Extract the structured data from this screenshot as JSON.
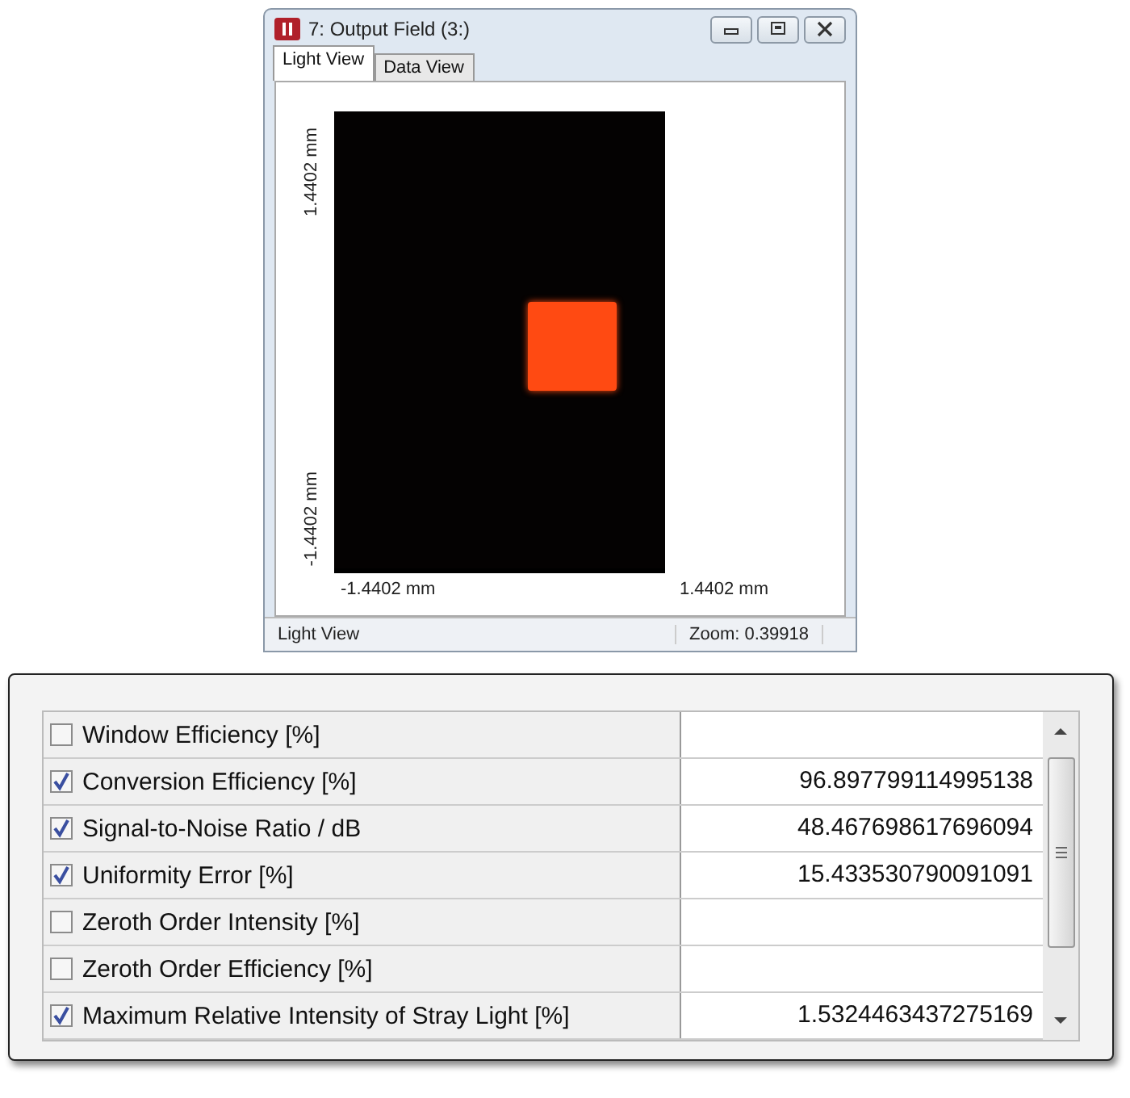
{
  "window": {
    "title": "7: Output Field (3:)"
  },
  "tabs": [
    {
      "label": "Light View",
      "selected": true
    },
    {
      "label": "Data View",
      "selected": false
    }
  ],
  "plot": {
    "y_top": "1.4402 mm",
    "y_bottom": "-1.4402 mm",
    "x_left": "-1.4402 mm",
    "x_right": "1.4402 mm"
  },
  "status_bar": {
    "view": "Light View",
    "zoom": "Zoom: 0.39918"
  },
  "table": {
    "rows": [
      {
        "label": "Window Efficiency [%]",
        "checked": false
      },
      {
        "label": "Conversion Efficiency [%]",
        "checked": true,
        "value": "96.897799114995138"
      },
      {
        "label": "Signal-to-Noise Ratio / dB",
        "checked": true,
        "value": "48.467698617696094"
      },
      {
        "label": "Uniformity Error [%]",
        "checked": true,
        "value": "15.433530790091091"
      },
      {
        "label": "Zeroth Order Intensity [%]",
        "checked": false
      },
      {
        "label": "Zeroth Order Efficiency [%]",
        "checked": false
      },
      {
        "label": "Maximum Relative Intensity of Stray Light [%]",
        "checked": true,
        "value": "1.5324463437275169"
      }
    ]
  }
}
